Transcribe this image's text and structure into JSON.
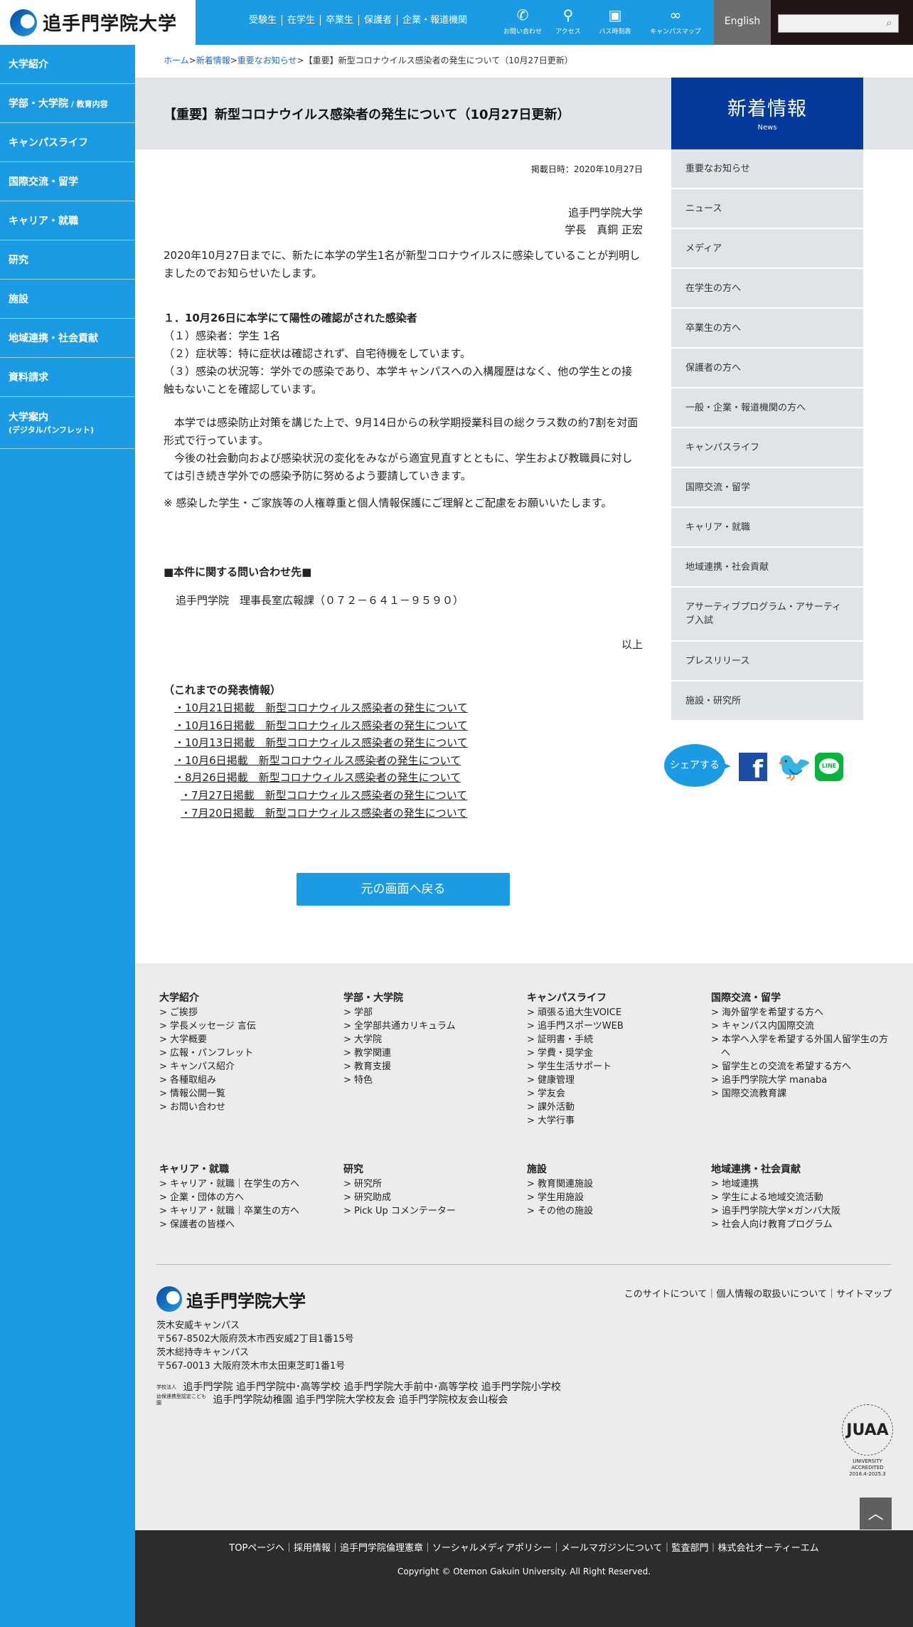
{
  "header": {
    "logo_text": "追手門学院大学",
    "quick_links": [
      "受験生",
      "在学生",
      "卒業生",
      "保護者",
      "企業・報道機関"
    ],
    "icons": [
      {
        "label": "お問い合わせ",
        "icon": "phone-icon"
      },
      {
        "label": "アクセス",
        "icon": "map-pin-icon"
      },
      {
        "label": "バス時刻表",
        "icon": "bus-icon"
      },
      {
        "label": "キャンパスマップ",
        "icon": "binoculars-icon"
      }
    ],
    "english_label": "English",
    "search_placeholder": ""
  },
  "left_nav": {
    "items": [
      {
        "label": "大学紹介",
        "sub": ""
      },
      {
        "label": "学部・大学院",
        "sub": " / 教育内容"
      },
      {
        "label": "キャンパスライフ",
        "sub": ""
      },
      {
        "label": "国際交流・留学",
        "sub": ""
      },
      {
        "label": "キャリア・就職",
        "sub": ""
      },
      {
        "label": "研究",
        "sub": ""
      },
      {
        "label": "施設",
        "sub": ""
      },
      {
        "label": "地域連携・社会貢献",
        "sub": ""
      },
      {
        "label": "資料請求",
        "sub": ""
      },
      {
        "label": "大学案内",
        "sub": "(デジタルパンフレット)"
      }
    ]
  },
  "breadcrumb": {
    "home": "ホーム",
    "news": "新着情報",
    "important": "重要なお知らせ",
    "current": "【重要】新型コロナウイルス感染者の発生について（10月27日更新）",
    "sep": ">"
  },
  "article": {
    "title": "【重要】新型コロナウイルス感染者の発生について（10月27日更新）",
    "date": "掲載日時：2020年10月27日",
    "signer_org": "追手門学院大学",
    "signer_name": "学長　真銅 正宏",
    "intro": "2020年10月27日までに、新たに本学の学生1名が新型コロナウイルスに感染していることが判明しましたのでお知らせいたします。",
    "case_heading": "１．10月26日に本学にて陽性の確認がされた感染者",
    "case_lines": [
      "（１）感染者：学生 1名",
      "（２）症状等：特に症状は確認されず、自宅待機をしています。",
      "（３）感染の状況等：学外での感染であり、本学キャンパスへの入構履歴はなく、他の学生との接触もないことを確認しています。"
    ],
    "para1": "　本学では感染防止対策を講じた上で、9月14日からの秋学期授業科目の総クラス数の約7割を対面形式で行っています。",
    "para2": "　今後の社会動向および感染状況の変化をみながら適宜見直すとともに、学生および教職員に対しては引き続き学外での感染予防に努めるよう要請していきます。",
    "note": "※ 感染した学生・ご家族等の人権尊重と個人情報保護にご理解とご配慮をお願いいたします。",
    "contact_heading": "■本件に関する問い合わせ先■",
    "contact": "追手門学院　理事長室広報課（０７２－６４１－９５９０）",
    "end": "以上",
    "prev_heading": "（これまでの発表情報）",
    "prev_links": [
      "・10月21日掲載　新型コロナウィルス感染者の発生について",
      "・10月16日掲載　新型コロナウィルス感染者の発生について",
      "・10月13日掲載　新型コロナウィルス感染者の発生について",
      "・10月6日掲載　新型コロナウィルス感染者の発生について",
      "・8月26日掲載　新型コロナウィルス感染者の発生について",
      "・7月27日掲載　新型コロナウィルス感染者の発生について",
      "・7月20日掲載　新型コロナウィルス感染者の発生について"
    ],
    "back_button": "元の画面へ戻る"
  },
  "side": {
    "box_title": "新着情報",
    "box_sub": "News",
    "items": [
      "重要なお知らせ",
      "ニュース",
      "メディア",
      "在学生の方へ",
      "卒業生の方へ",
      "保護者の方へ",
      "一般・企業・報道機関の方へ",
      "キャンパスライフ",
      "国際交流・留学",
      "キャリア・就職",
      "地域連携・社会貢献",
      "アサーティブプログラム・アサーティブ入試",
      "プレスリリース",
      "施設・研究所"
    ],
    "share_label": "シェアする",
    "line_label": "LINE"
  },
  "footer": {
    "columns": [
      {
        "heading": "大学紹介",
        "links": [
          "ご挨拶",
          "学長メッセージ 言伝",
          "大学概要",
          "広報・パンフレット",
          "キャンパス紹介",
          "各種取組み",
          "情報公開一覧",
          "お問い合わせ"
        ]
      },
      {
        "heading": "学部・大学院",
        "links": [
          "学部",
          "全学部共通カリキュラム",
          "大学院",
          "教学関連",
          "教育支援",
          "特色"
        ]
      },
      {
        "heading": "キャンパスライフ",
        "links": [
          "頑張る追大生VOICE",
          "追手門スポーツWEB",
          "証明書・手続",
          "学費・奨学金",
          "学生生活サポート",
          "健康管理",
          "学友会",
          "課外活動",
          "大学行事"
        ]
      },
      {
        "heading": "国際交流・留学",
        "links": [
          "海外留学を希望する方へ",
          "キャンパス内国際交流",
          "本学へ入学を希望する外国人留学生の方へ",
          "留学生との交流を希望する方へ",
          "追手門学院大学 manaba",
          "国際交流教育課"
        ]
      },
      {
        "heading": "キャリア・就職",
        "links": [
          "キャリア・就職｜在学生の方へ",
          "企業・団体の方へ",
          "キャリア・就職｜卒業生の方へ",
          "保護者の皆様へ"
        ]
      },
      {
        "heading": "研究",
        "links": [
          "研究所",
          "研究助成",
          "Pick Up コメンテーター"
        ]
      },
      {
        "heading": "施設",
        "links": [
          "教育関連施設",
          "学生用施設",
          "その他の施設"
        ]
      },
      {
        "heading": "地域連携・社会貢献",
        "links": [
          "地域連携",
          "学生による地域交流活動",
          "追手門学院大学×ガンバ大阪",
          "社会人向け教育プログラム"
        ]
      }
    ],
    "site_links": "このサイトについて｜個人情報の取扱いについて｜サイトマップ",
    "logo_text": "追手門学院大学",
    "address_lines": [
      "茨木安威キャンパス",
      "〒567-8502大阪府茨木市西安威2丁目1番15号",
      "茨木総持寺キャンパス",
      "〒567-0013 大阪府茨木市太田東芝町1番1号"
    ],
    "group_label1": "学校法人",
    "group_line1": "追手門学院 追手門学院中･高等学校 追手門学院大手前中･高等学校 追手門学院小学校",
    "group_label2": "幼保連携型認定こども園",
    "group_line2": "追手門学院幼稚園 追手門学院大学校友会 追手門学院校友会山桜会",
    "badge_ring": "JUAA",
    "badge_text1": "UNIVERSITY",
    "badge_text2": "ACCREDITED",
    "badge_text3": "2018.4-2025.3",
    "bottom_links": "TOPページへ｜採用情報｜追手門学院倫理憲章｜ソーシャルメディアポリシー｜メールマガジンについて｜監査部門｜株式会社オーティーエム",
    "copyright": "Copyright © Otemon Gakuin University.  All Right Reserved."
  }
}
